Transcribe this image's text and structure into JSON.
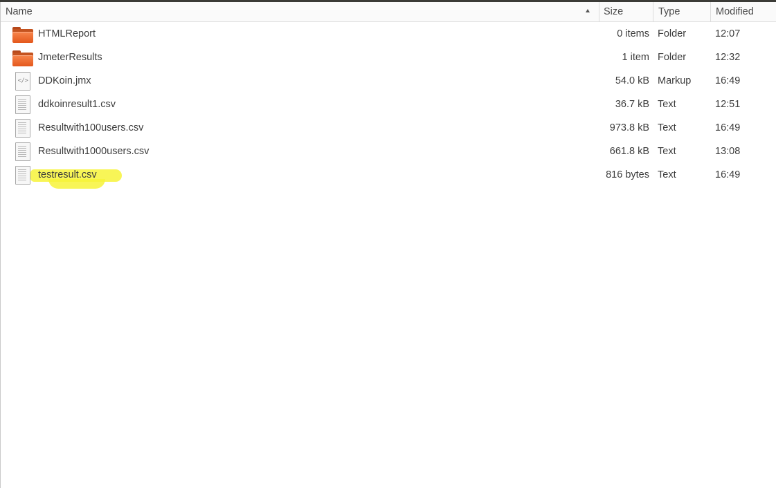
{
  "header": {
    "name": "Name",
    "size": "Size",
    "type": "Type",
    "modified": "Modified",
    "sort_icon": "sort-ascending-icon"
  },
  "files": [
    {
      "name": "HTMLReport",
      "size": "0 items",
      "type": "Folder",
      "modified": "12:07",
      "icon": "folder-icon"
    },
    {
      "name": "JmeterResults",
      "size": "1 item",
      "type": "Folder",
      "modified": "12:32",
      "icon": "folder-icon"
    },
    {
      "name": "DDKoin.jmx",
      "size": "54.0 kB",
      "type": "Markup",
      "modified": "16:49",
      "icon": "markup-file-icon",
      "icon_glyph": "</>"
    },
    {
      "name": "ddkoinresult1.csv",
      "size": "36.7 kB",
      "type": "Text",
      "modified": "12:51",
      "icon": "text-file-icon"
    },
    {
      "name": "Resultwith100users.csv",
      "size": "973.8 kB",
      "type": "Text",
      "modified": "16:49",
      "icon": "text-file-icon"
    },
    {
      "name": "Resultwith1000users.csv",
      "size": "661.8 kB",
      "type": "Text",
      "modified": "13:08",
      "icon": "text-file-icon"
    },
    {
      "name": "testresult.csv",
      "size": "816 bytes",
      "type": "Text",
      "modified": "16:49",
      "icon": "text-file-icon",
      "highlighted": true
    }
  ],
  "colors": {
    "folder": "#e95f22",
    "highlight": "#f7f33a",
    "text": "#3c3c3c"
  }
}
